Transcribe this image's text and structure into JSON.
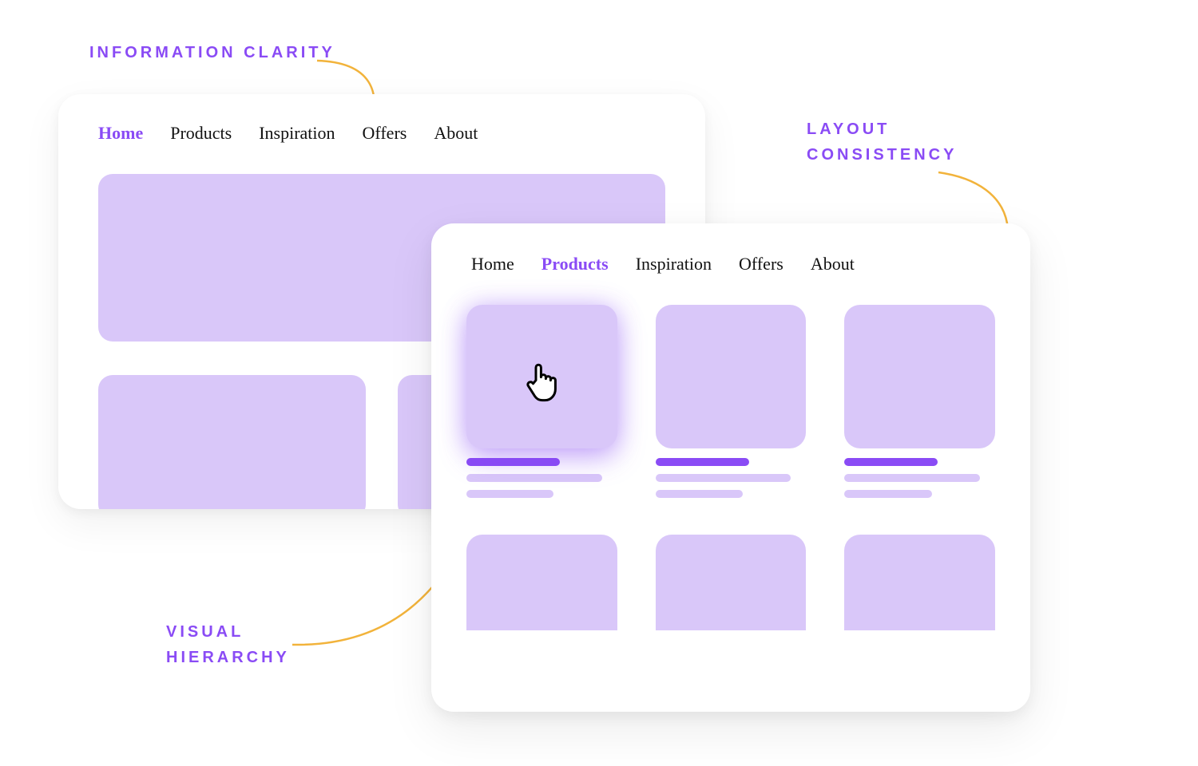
{
  "labels": {
    "info_clarity": "INFORMATION CLARITY",
    "layout_consistency_l1": "LAYOUT",
    "layout_consistency_l2": "CONSISTENCY",
    "visual_hierarchy_l1": "VISUAL",
    "visual_hierarchy_l2": "HIERARCHY"
  },
  "nav_items": {
    "home": "Home",
    "products": "Products",
    "inspiration": "Inspiration",
    "offers": "Offers",
    "about": "About"
  },
  "colors": {
    "accent": "#8a4bf5",
    "fill": "#d9c7f9",
    "arrow": "#f2b33b"
  }
}
